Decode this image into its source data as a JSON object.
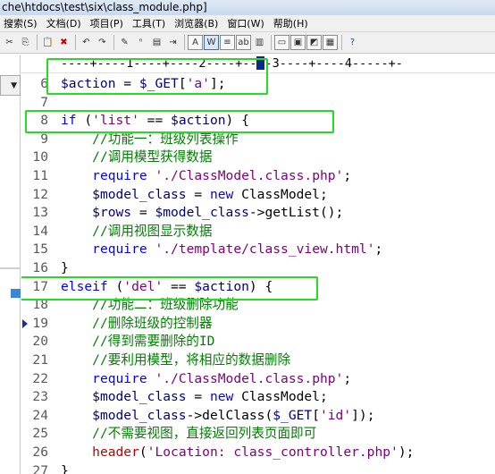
{
  "window": {
    "title": "che\\htdocs\\test\\six\\class_module.php]"
  },
  "menu": [
    "搜索(S)",
    "文档(D)",
    "项目(P)",
    "工具(T)",
    "浏览器(B)",
    "窗口(W)",
    "帮助(H)"
  ],
  "toolbar": {
    "buttons": [
      {
        "icon": "cut-icon",
        "glyph": "✂"
      },
      {
        "icon": "copy-icon",
        "glyph": "⎘"
      },
      {
        "icon": "paste-icon",
        "glyph": "📋"
      },
      {
        "icon": "delete-icon",
        "glyph": "✖"
      },
      {
        "icon": "undo-icon",
        "glyph": "↶"
      },
      {
        "icon": "redo-icon",
        "glyph": "↷"
      },
      {
        "icon": "find-icon",
        "glyph": "✎"
      },
      {
        "icon": "replace-icon",
        "glyph": "ⁿ"
      },
      {
        "icon": "find-in-files-icon",
        "glyph": "▤"
      },
      {
        "icon": "indent-icon",
        "glyph": "⇥"
      },
      {
        "icon": "font-icon",
        "glyph": "A"
      },
      {
        "icon": "word-wrap-icon",
        "glyph": "W"
      },
      {
        "icon": "ruler-icon",
        "glyph": "≡"
      },
      {
        "icon": "hex-icon",
        "glyph": "ab"
      },
      {
        "icon": "column-mode-icon",
        "glyph": "▥"
      },
      {
        "icon": "window-icon",
        "glyph": "▭"
      },
      {
        "icon": "tile-icon",
        "glyph": "▣"
      },
      {
        "icon": "cascade-icon",
        "glyph": "◩"
      },
      {
        "icon": "browser-icon",
        "glyph": "▦"
      },
      {
        "icon": "help-icon",
        "glyph": "?"
      }
    ]
  },
  "ruler": {
    "text_before": "----+----1----+----2----+--",
    "text_after": "-3----+----4-----+-"
  },
  "code_lines": [
    {
      "num": "6",
      "tokens": [
        [
          "var",
          "$action"
        ],
        [
          "op",
          " = "
        ],
        [
          "var",
          "$_GET"
        ],
        [
          "op",
          "["
        ],
        [
          "str",
          "'a'"
        ],
        [
          "op",
          "];"
        ]
      ]
    },
    {
      "num": "7",
      "tokens": []
    },
    {
      "num": "8",
      "tokens": [
        [
          "kw",
          "if"
        ],
        [
          "op",
          " ("
        ],
        [
          "str",
          "'list'"
        ],
        [
          "op",
          " == "
        ],
        [
          "var",
          "$action"
        ],
        [
          "op",
          ") {"
        ]
      ]
    },
    {
      "num": "9",
      "tokens": [
        [
          "op",
          "    "
        ],
        [
          "cm",
          "//功能一：班级列表操作"
        ]
      ]
    },
    {
      "num": "10",
      "tokens": [
        [
          "op",
          "    "
        ],
        [
          "cm",
          "//调用模型获得数据"
        ]
      ]
    },
    {
      "num": "11",
      "tokens": [
        [
          "op",
          "    "
        ],
        [
          "kw",
          "require"
        ],
        [
          "op",
          " "
        ],
        [
          "str",
          "'./ClassModel.class.php'"
        ],
        [
          "op",
          ";"
        ]
      ]
    },
    {
      "num": "12",
      "tokens": [
        [
          "op",
          "    "
        ],
        [
          "var",
          "$model_class"
        ],
        [
          "op",
          " = "
        ],
        [
          "kw",
          "new"
        ],
        [
          "op",
          " ClassModel;"
        ]
      ]
    },
    {
      "num": "13",
      "tokens": [
        [
          "op",
          "    "
        ],
        [
          "var",
          "$rows"
        ],
        [
          "op",
          " = "
        ],
        [
          "var",
          "$model_class"
        ],
        [
          "op",
          "->getList();"
        ]
      ]
    },
    {
      "num": "14",
      "tokens": [
        [
          "op",
          "    "
        ],
        [
          "cm",
          "//调用视图显示数据"
        ]
      ]
    },
    {
      "num": "15",
      "tokens": [
        [
          "op",
          "    "
        ],
        [
          "kw",
          "require"
        ],
        [
          "op",
          " "
        ],
        [
          "str",
          "'./template/class_view.html'"
        ],
        [
          "op",
          ";"
        ]
      ]
    },
    {
      "num": "16",
      "tokens": [
        [
          "op",
          "}"
        ]
      ]
    },
    {
      "num": "17",
      "tokens": [
        [
          "kw",
          "elseif"
        ],
        [
          "op",
          " ("
        ],
        [
          "str",
          "'del'"
        ],
        [
          "op",
          " == "
        ],
        [
          "var",
          "$action"
        ],
        [
          "op",
          ") {"
        ]
      ]
    },
    {
      "num": "18",
      "tokens": [
        [
          "op",
          "    "
        ],
        [
          "cm",
          "//功能二：班级删除功能"
        ]
      ]
    },
    {
      "num": "19",
      "tokens": [
        [
          "op",
          "    "
        ],
        [
          "cm",
          "//删除班级的控制器"
        ]
      ]
    },
    {
      "num": "20",
      "tokens": [
        [
          "op",
          "    "
        ],
        [
          "cm",
          "//得到需要删除的ID"
        ]
      ]
    },
    {
      "num": "21",
      "tokens": [
        [
          "op",
          "    "
        ],
        [
          "cm",
          "//要利用模型，将相应的数据删除"
        ]
      ]
    },
    {
      "num": "22",
      "tokens": [
        [
          "op",
          "    "
        ],
        [
          "kw",
          "require"
        ],
        [
          "op",
          " "
        ],
        [
          "str",
          "'./ClassModel.class.php'"
        ],
        [
          "op",
          ";"
        ]
      ]
    },
    {
      "num": "23",
      "tokens": [
        [
          "op",
          "    "
        ],
        [
          "var",
          "$model_class"
        ],
        [
          "op",
          " = "
        ],
        [
          "kw",
          "new"
        ],
        [
          "op",
          " ClassModel;"
        ]
      ]
    },
    {
      "num": "24",
      "tokens": [
        [
          "op",
          "    "
        ],
        [
          "var",
          "$model_class"
        ],
        [
          "op",
          "->delClass("
        ],
        [
          "var",
          "$_GET"
        ],
        [
          "op",
          "["
        ],
        [
          "str",
          "'id'"
        ],
        [
          "op",
          "]);"
        ]
      ]
    },
    {
      "num": "25",
      "tokens": [
        [
          "op",
          "    "
        ],
        [
          "cm",
          "//不需要视图，直接返回列表页面即可"
        ]
      ]
    },
    {
      "num": "26",
      "tokens": [
        [
          "op",
          "    "
        ],
        [
          "hdr",
          "header"
        ],
        [
          "op",
          "("
        ],
        [
          "str",
          "'Location: class_controller.php'"
        ],
        [
          "op",
          ");"
        ]
      ]
    },
    {
      "num": "27",
      "tokens": [
        [
          "op",
          "}"
        ]
      ]
    }
  ],
  "breakpoint_line": "19",
  "annotation_color": "#22dd22",
  "colors": {
    "keyword": "#0000ff",
    "variable": "#000080",
    "string": "#800080",
    "comment": "#008000"
  }
}
